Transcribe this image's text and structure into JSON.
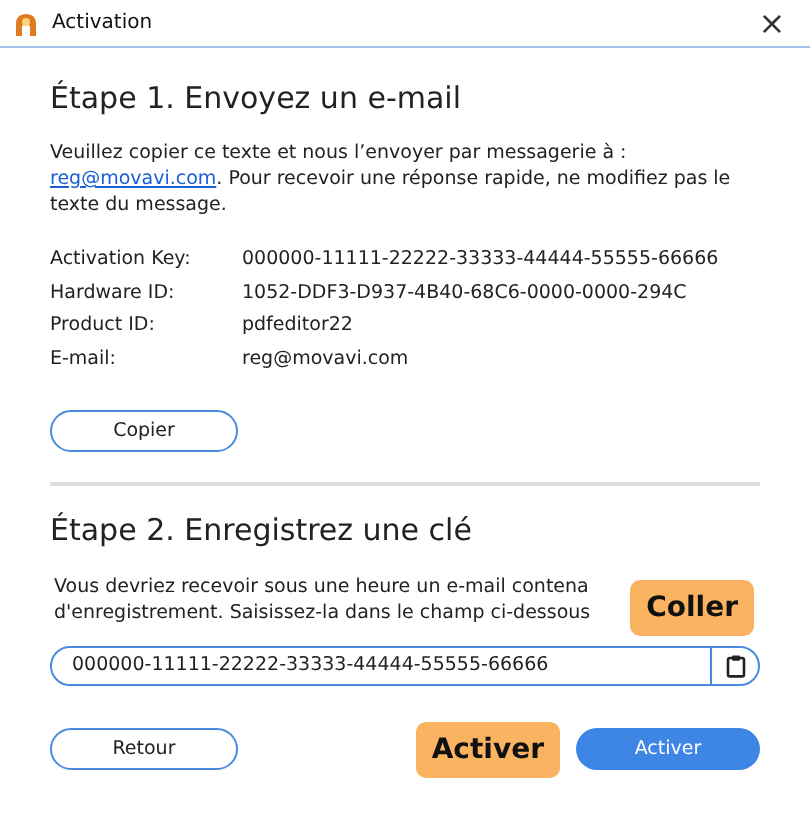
{
  "window": {
    "title": "Activation",
    "close": "×"
  },
  "step1": {
    "heading": "Étape 1. Envoyez un e-mail",
    "intro_before": "Veuillez copier ce texte et nous l’envoyer par messagerie à :",
    "intro_link": "reg@movavi.com",
    "intro_after": ". Pour recevoir une réponse rapide, ne modifiez pas le texte du message.",
    "fields": [
      {
        "label": "Activation Key:",
        "value": "000000-11111-22222-33333-44444-55555-66666"
      },
      {
        "label": "Hardware ID:",
        "value": "1052-DDF3-D937-4B40-68C6-0000-0000-294C"
      },
      {
        "label": "Product ID:",
        "value": "pdfeditor22"
      },
      {
        "label": "E-mail:",
        "value": "reg@movavi.com"
      }
    ],
    "copy_button": "Copier"
  },
  "step2": {
    "heading": "Étape 2. Enregistrez une clé",
    "lines": [
      "Vous devriez recevoir sous une heure un e-mail contena",
      "d'enregistrement. Saisissez-la dans le champ ci-dessous"
    ],
    "key_value": "000000-11111-22222-33333-44444-55555-66666",
    "back_button": "Retour",
    "activate_button": "Activer"
  },
  "callouts": [
    {
      "kind": "paste",
      "text": "Coller"
    },
    {
      "kind": "activate",
      "text": "Activer"
    }
  ]
}
